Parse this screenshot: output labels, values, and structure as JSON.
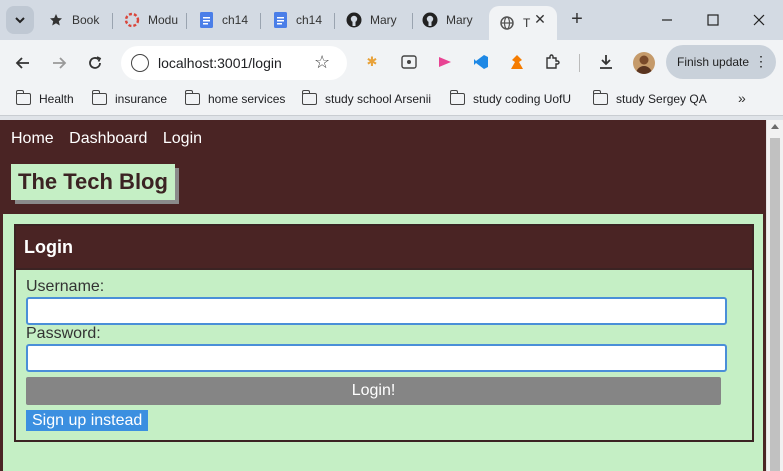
{
  "browser": {
    "tabs": [
      {
        "title": "Book",
        "icon": "star-icon"
      },
      {
        "title": "Modu",
        "icon": "module-icon"
      },
      {
        "title": "ch14",
        "icon": "doc-icon"
      },
      {
        "title": "ch14",
        "icon": "doc-icon"
      },
      {
        "title": "Mary",
        "icon": "github-icon"
      },
      {
        "title": "Mary",
        "icon": "github-icon"
      },
      {
        "title": "T",
        "icon": "globe-icon"
      }
    ],
    "url": "localhost:3001/login",
    "finish_update_label": "Finish update",
    "bookmarks": [
      "Health",
      "insurance",
      "home services",
      "study school Arsenii",
      "study coding UofU",
      "study Sergey QA"
    ]
  },
  "site": {
    "nav": [
      "Home",
      "Dashboard",
      "Login"
    ],
    "brand": "The Tech Blog"
  },
  "login_form": {
    "heading": "Login",
    "username_label": "Username:",
    "username_value": "",
    "password_label": "Password:",
    "password_value": "",
    "submit_label": "Login!",
    "signup_label": "Sign up instead"
  },
  "colors": {
    "header_bg": "#4a2424",
    "content_bg": "#c5efc5",
    "submit_bg": "#858585",
    "signup_bg": "#3b8fe0"
  }
}
